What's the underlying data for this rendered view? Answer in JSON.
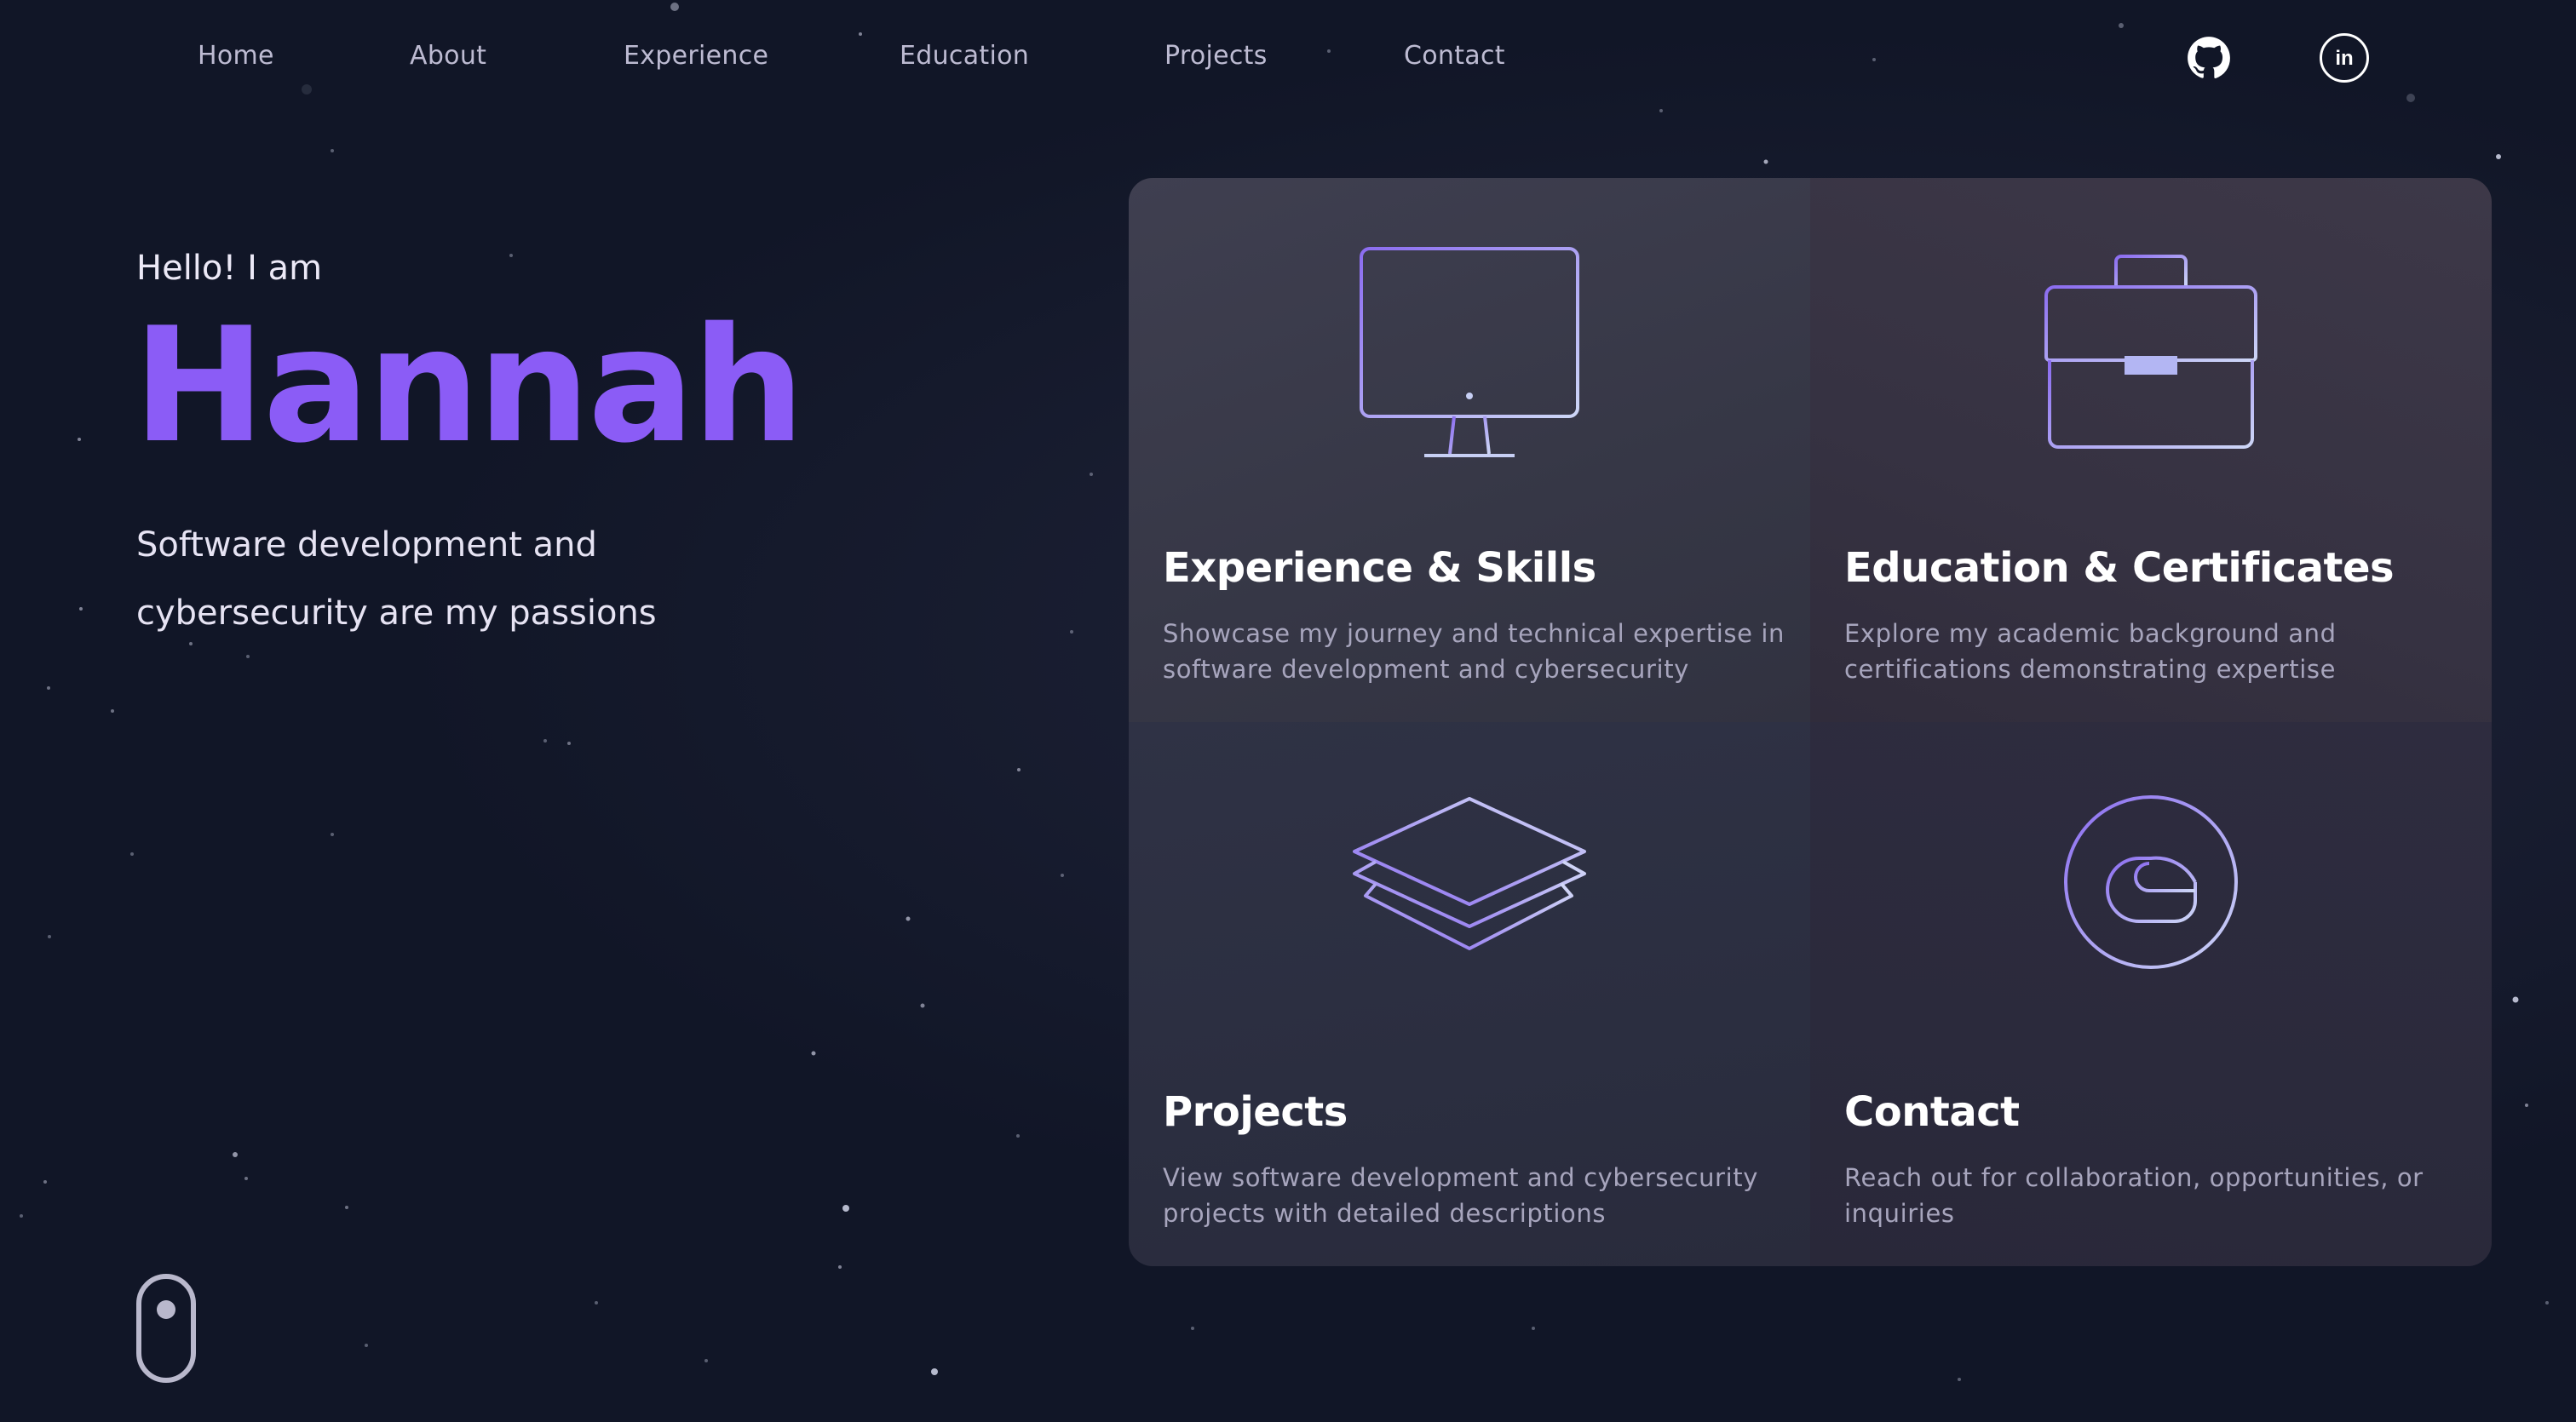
{
  "nav": {
    "items": [
      {
        "label": "Home"
      },
      {
        "label": "About"
      },
      {
        "label": "Experience"
      },
      {
        "label": "Education"
      },
      {
        "label": "Projects"
      },
      {
        "label": "Contact"
      }
    ],
    "social": [
      {
        "icon": "github-icon"
      },
      {
        "icon": "linkedin-icon",
        "text": "in"
      }
    ]
  },
  "hero": {
    "greeting": "Hello! I am",
    "name": "Hannah",
    "tagline": "Software development and cybersecurity are my passions"
  },
  "cards": [
    {
      "icon": "monitor-icon",
      "title": "Experience & Skills",
      "description": "Showcase my journey and technical expertise in software development and cybersecurity"
    },
    {
      "icon": "briefcase-icon",
      "title": "Education & Certificates",
      "description": "Explore my academic background and certifications demonstrating expertise"
    },
    {
      "icon": "layers-icon",
      "title": "Projects",
      "description": "View software development and cybersecurity projects with detailed descriptions"
    },
    {
      "icon": "at-sign-icon",
      "title": "Contact",
      "description": "Reach out for collaboration, opportunities, or inquiries"
    }
  ],
  "scroll_indicator": {
    "icon": "mouse-scroll-icon"
  },
  "colors": {
    "background": "#111627",
    "accent": "#8b5cf6",
    "icon_gradient_start": "#8b6cf0",
    "icon_gradient_end": "#c9d2f5"
  }
}
